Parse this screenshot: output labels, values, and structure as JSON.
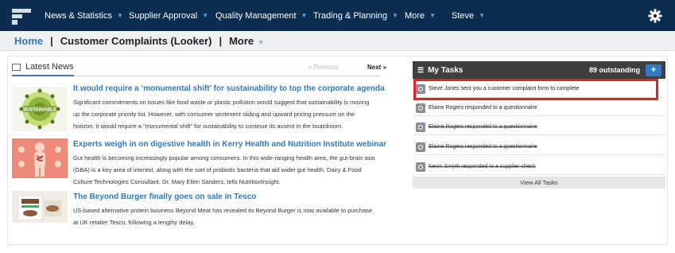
{
  "nav": {
    "items": [
      {
        "label": "News & Statistics"
      },
      {
        "label": "Supplier Approval"
      },
      {
        "label": "Quality Management"
      },
      {
        "label": "Trading & Planning"
      },
      {
        "label": "More"
      },
      {
        "label": "Steve"
      }
    ],
    "caret": "▼"
  },
  "breadcrumb": {
    "home": "Home",
    "page": "Customer Complaints (Looker)",
    "more": "More",
    "separator": "|"
  },
  "news": {
    "title": "Latest News",
    "prev": "« Previous",
    "next": "Next »",
    "articles": [
      {
        "title": "It would require a ‘monumental shift’ for sustainability to top the corporate agenda",
        "lines": [
          "Significant commitments on issues like food waste or plastic pollution would suggest that sustainability is moving",
          "up the corporate priority list. However, with consumer sentiment sliding and upward pricing pressure on the",
          "horizon, it would require a “monumental shift” for sustainability to continue its assent in the boardroom."
        ],
        "thumb_text": "SUSTAINABLE"
      },
      {
        "title": "Experts weigh in on digestive health in Kerry Health and Nutrition Institute webinar",
        "lines": [
          "Gut health is becoming increasingly popular among consumers. In this wide-ranging health area, the gut-brain axis",
          "(GBA) is a key area of interest, along with the sort of probiotic bacteria that aid wider gut health, Dairy & Food",
          "Culture Technologies Consultant, Dr. Mary Ellen Sanders, tells NutritionInsight."
        ]
      },
      {
        "title": "The Beyond Burger finally goes on sale in Tesco",
        "lines": [
          "US-based alternative protein business Beyond Meat has revealed its Beyond Burger is now available to purchase",
          "at UK retailer Tesco, following a lengthy delay."
        ]
      }
    ]
  },
  "tasks": {
    "title": "My Tasks",
    "count": "89 outstanding",
    "add": "+",
    "items": [
      {
        "text": "Steve Jones sent you a customer complaint form to complete",
        "done": false
      },
      {
        "text": "Elaine Rogers responded to a questionnaire",
        "done": false
      },
      {
        "text": "Elaine Rogers responded to a questionnaire",
        "done": true
      },
      {
        "text": "Elaine Rogers responded to a questionnaire",
        "done": true
      },
      {
        "text": "Kevin Smyth responded to a supplier check",
        "done": true
      }
    ],
    "view_all": "View All Tasks"
  },
  "colors": {
    "topbar": "#0b2d52",
    "accent": "#2f7ac2",
    "highlight": "#e8202a"
  },
  "icons": {
    "logo": "app-logo",
    "settings": "gear-icon",
    "tasks": "list-icon",
    "task_item": "circle-icon"
  }
}
